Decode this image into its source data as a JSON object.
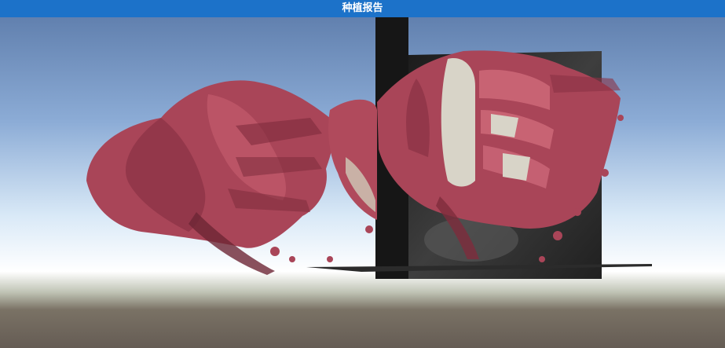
{
  "header": {
    "title": "种植报告"
  },
  "scene": {
    "sky_top_color": "#5f7fae",
    "sky_mid_color": "#a9c4e4",
    "horizon_color": "#f5fbff",
    "ground_color": "#6e655c",
    "bone_model_color": "#b04a5c",
    "implant_color": "#d8d4c8",
    "ct_slice_color": "#2a2a2a"
  }
}
